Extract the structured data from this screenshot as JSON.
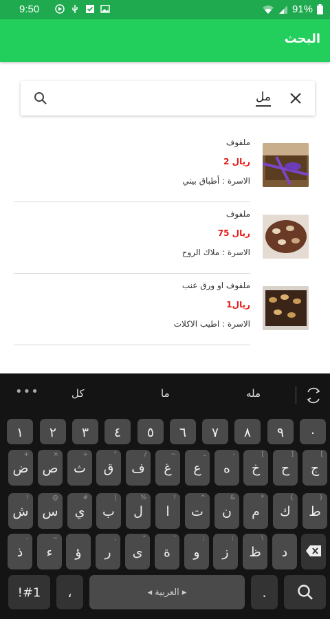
{
  "status_bar": {
    "time": "9:50",
    "battery": "91%"
  },
  "app_bar": {
    "title": "البحث"
  },
  "search": {
    "query": "مل"
  },
  "results": [
    {
      "name": "ملفوف",
      "price": "ريال 2",
      "family": "الاسرة : أطباق بيتي"
    },
    {
      "name": "ملفوف",
      "price": "ريال 75",
      "family": "الاسرة : ملاك الروح"
    },
    {
      "name": "ملفوف او ورق عنب",
      "price": "ريال1",
      "family": "الاسرة : اطيب الاكلات"
    }
  ],
  "keyboard": {
    "suggestions": {
      "left": "كل",
      "middle": "ما",
      "right": "مله",
      "more": "•••"
    },
    "digits": [
      "٠",
      "٩",
      "٨",
      "٧",
      "٦",
      "٥",
      "٤",
      "٣",
      "٢",
      "١"
    ],
    "row1": [
      {
        "k": "ج",
        "h": "["
      },
      {
        "k": "ح",
        "h": "]"
      },
      {
        "k": "خ",
        "h": "["
      },
      {
        "k": "ه",
        "h": "-"
      },
      {
        "k": "ع",
        "h": "ـ"
      },
      {
        "k": "غ",
        "h": "~"
      },
      {
        "k": "ف",
        "h": "/"
      },
      {
        "k": "ق",
        "h": "\""
      },
      {
        "k": "ث",
        "h": "÷"
      },
      {
        "k": "ص",
        "h": "×"
      },
      {
        "k": "ض",
        "h": "+"
      }
    ],
    "row2": [
      {
        "k": "ط",
        "h": "}"
      },
      {
        "k": "ك",
        "h": "{"
      },
      {
        "k": "م",
        "h": "*"
      },
      {
        "k": "ن",
        "h": "&"
      },
      {
        "k": "ت",
        "h": "^"
      },
      {
        "k": "ا",
        "h": "!"
      },
      {
        "k": "ل",
        "h": "%"
      },
      {
        "k": "ب",
        "h": "|"
      },
      {
        "k": "ي",
        "h": "#"
      },
      {
        "k": "س",
        "h": "@"
      },
      {
        "k": "ش",
        "h": "!"
      }
    ],
    "row3": [
      {
        "k": "د",
        "h": ""
      },
      {
        "k": "ظ",
        "h": "\\"
      },
      {
        "k": "ز",
        "h": ":"
      },
      {
        "k": "و",
        "h": ";"
      },
      {
        "k": "ة",
        "h": "'"
      },
      {
        "k": "ى",
        "h": "\""
      },
      {
        "k": "ر",
        "h": ","
      },
      {
        "k": "ؤ",
        "h": ""
      },
      {
        "k": "ء",
        "h": "~"
      },
      {
        "k": "ذ",
        "h": "-"
      }
    ],
    "symbols_label": "!#1",
    "comma": "،",
    "space_label": "العربية",
    "period": "."
  }
}
